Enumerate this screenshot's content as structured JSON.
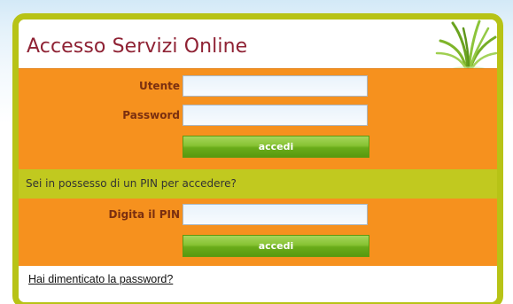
{
  "header": {
    "title": "Accesso Servizi Online",
    "logo_icon": "grass-icon"
  },
  "login_form": {
    "username_label": "Utente",
    "username_value": "",
    "password_label": "Password",
    "password_value": "",
    "submit_label": "accedi"
  },
  "pin_notice": {
    "text": "Sei in possesso di un PIN per accedere?"
  },
  "pin_form": {
    "pin_label": "Digita il PIN",
    "pin_value": "",
    "submit_label": "accedi"
  },
  "footer": {
    "forgot_password_link": "Hai dimenticato la password?"
  },
  "colors": {
    "panel_border": "#b7c316",
    "form_background": "#f6911e",
    "notice_background": "#c1c91f",
    "title_color": "#8f2234",
    "label_color": "#7a2f10",
    "button_green": "#78b626"
  }
}
